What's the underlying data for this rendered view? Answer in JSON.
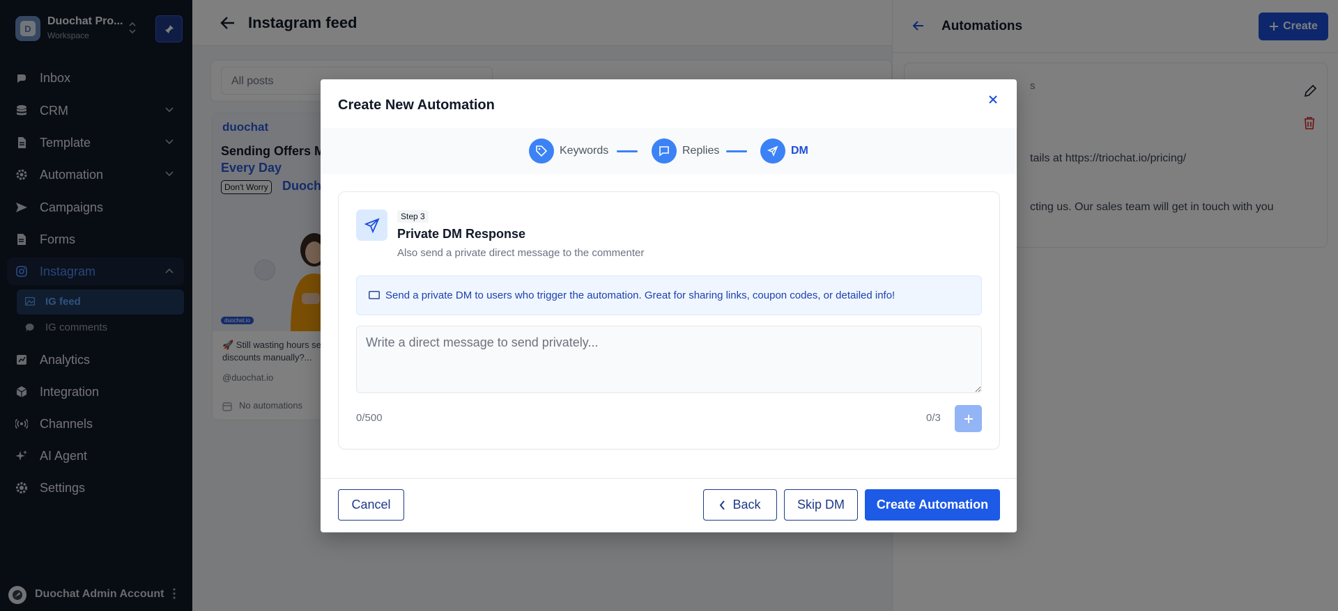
{
  "workspace": {
    "initial": "D",
    "name": "Duochat Pro...",
    "subtitle": "Workspace"
  },
  "nav": {
    "inbox": "Inbox",
    "crm": "CRM",
    "template": "Template",
    "automation": "Automation",
    "campaigns": "Campaigns",
    "forms": "Forms",
    "instagram": "Instagram",
    "ig_feed": "IG feed",
    "ig_comments": "IG comments",
    "analytics": "Analytics",
    "integration": "Integration",
    "channels": "Channels",
    "ai_agent": "AI Agent",
    "settings": "Settings"
  },
  "account": {
    "name": "Duochat Admin Account"
  },
  "main": {
    "title": "Instagram feed",
    "filter": "All posts",
    "post": {
      "logo": "duochat",
      "headline1": "Sending Offers M",
      "headline2": "Every Day",
      "badge": "Don't Worry",
      "brand": "Duocha",
      "tag": "duochat.io",
      "caption": "🚀 Still wasting hours se discounts manually?...",
      "handle": "@duochat.io",
      "automations": "No automations"
    }
  },
  "panel": {
    "title": "Automations",
    "create_label": "Create",
    "card": {
      "hidden_title": "s",
      "line1": "tails at https://triochat.io/pricing/",
      "line2": "cting us. Our sales team will get in touch with you"
    }
  },
  "modal": {
    "title": "Create New Automation",
    "steps": [
      {
        "label": "Keywords"
      },
      {
        "label": "Replies"
      },
      {
        "label": "DM"
      }
    ],
    "step_badge": "Step 3",
    "step_title": "Private DM Response",
    "step_subtitle": "Also send a private direct message to the commenter",
    "info": "Send a private DM to users who trigger the automation. Great for sharing links, coupon codes, or detailed info!",
    "textarea_placeholder": "Write a direct message to send privately...",
    "char_count": "0/500",
    "message_count": "0/3",
    "cancel": "Cancel",
    "back": "Back",
    "skip": "Skip DM",
    "create": "Create Automation"
  }
}
